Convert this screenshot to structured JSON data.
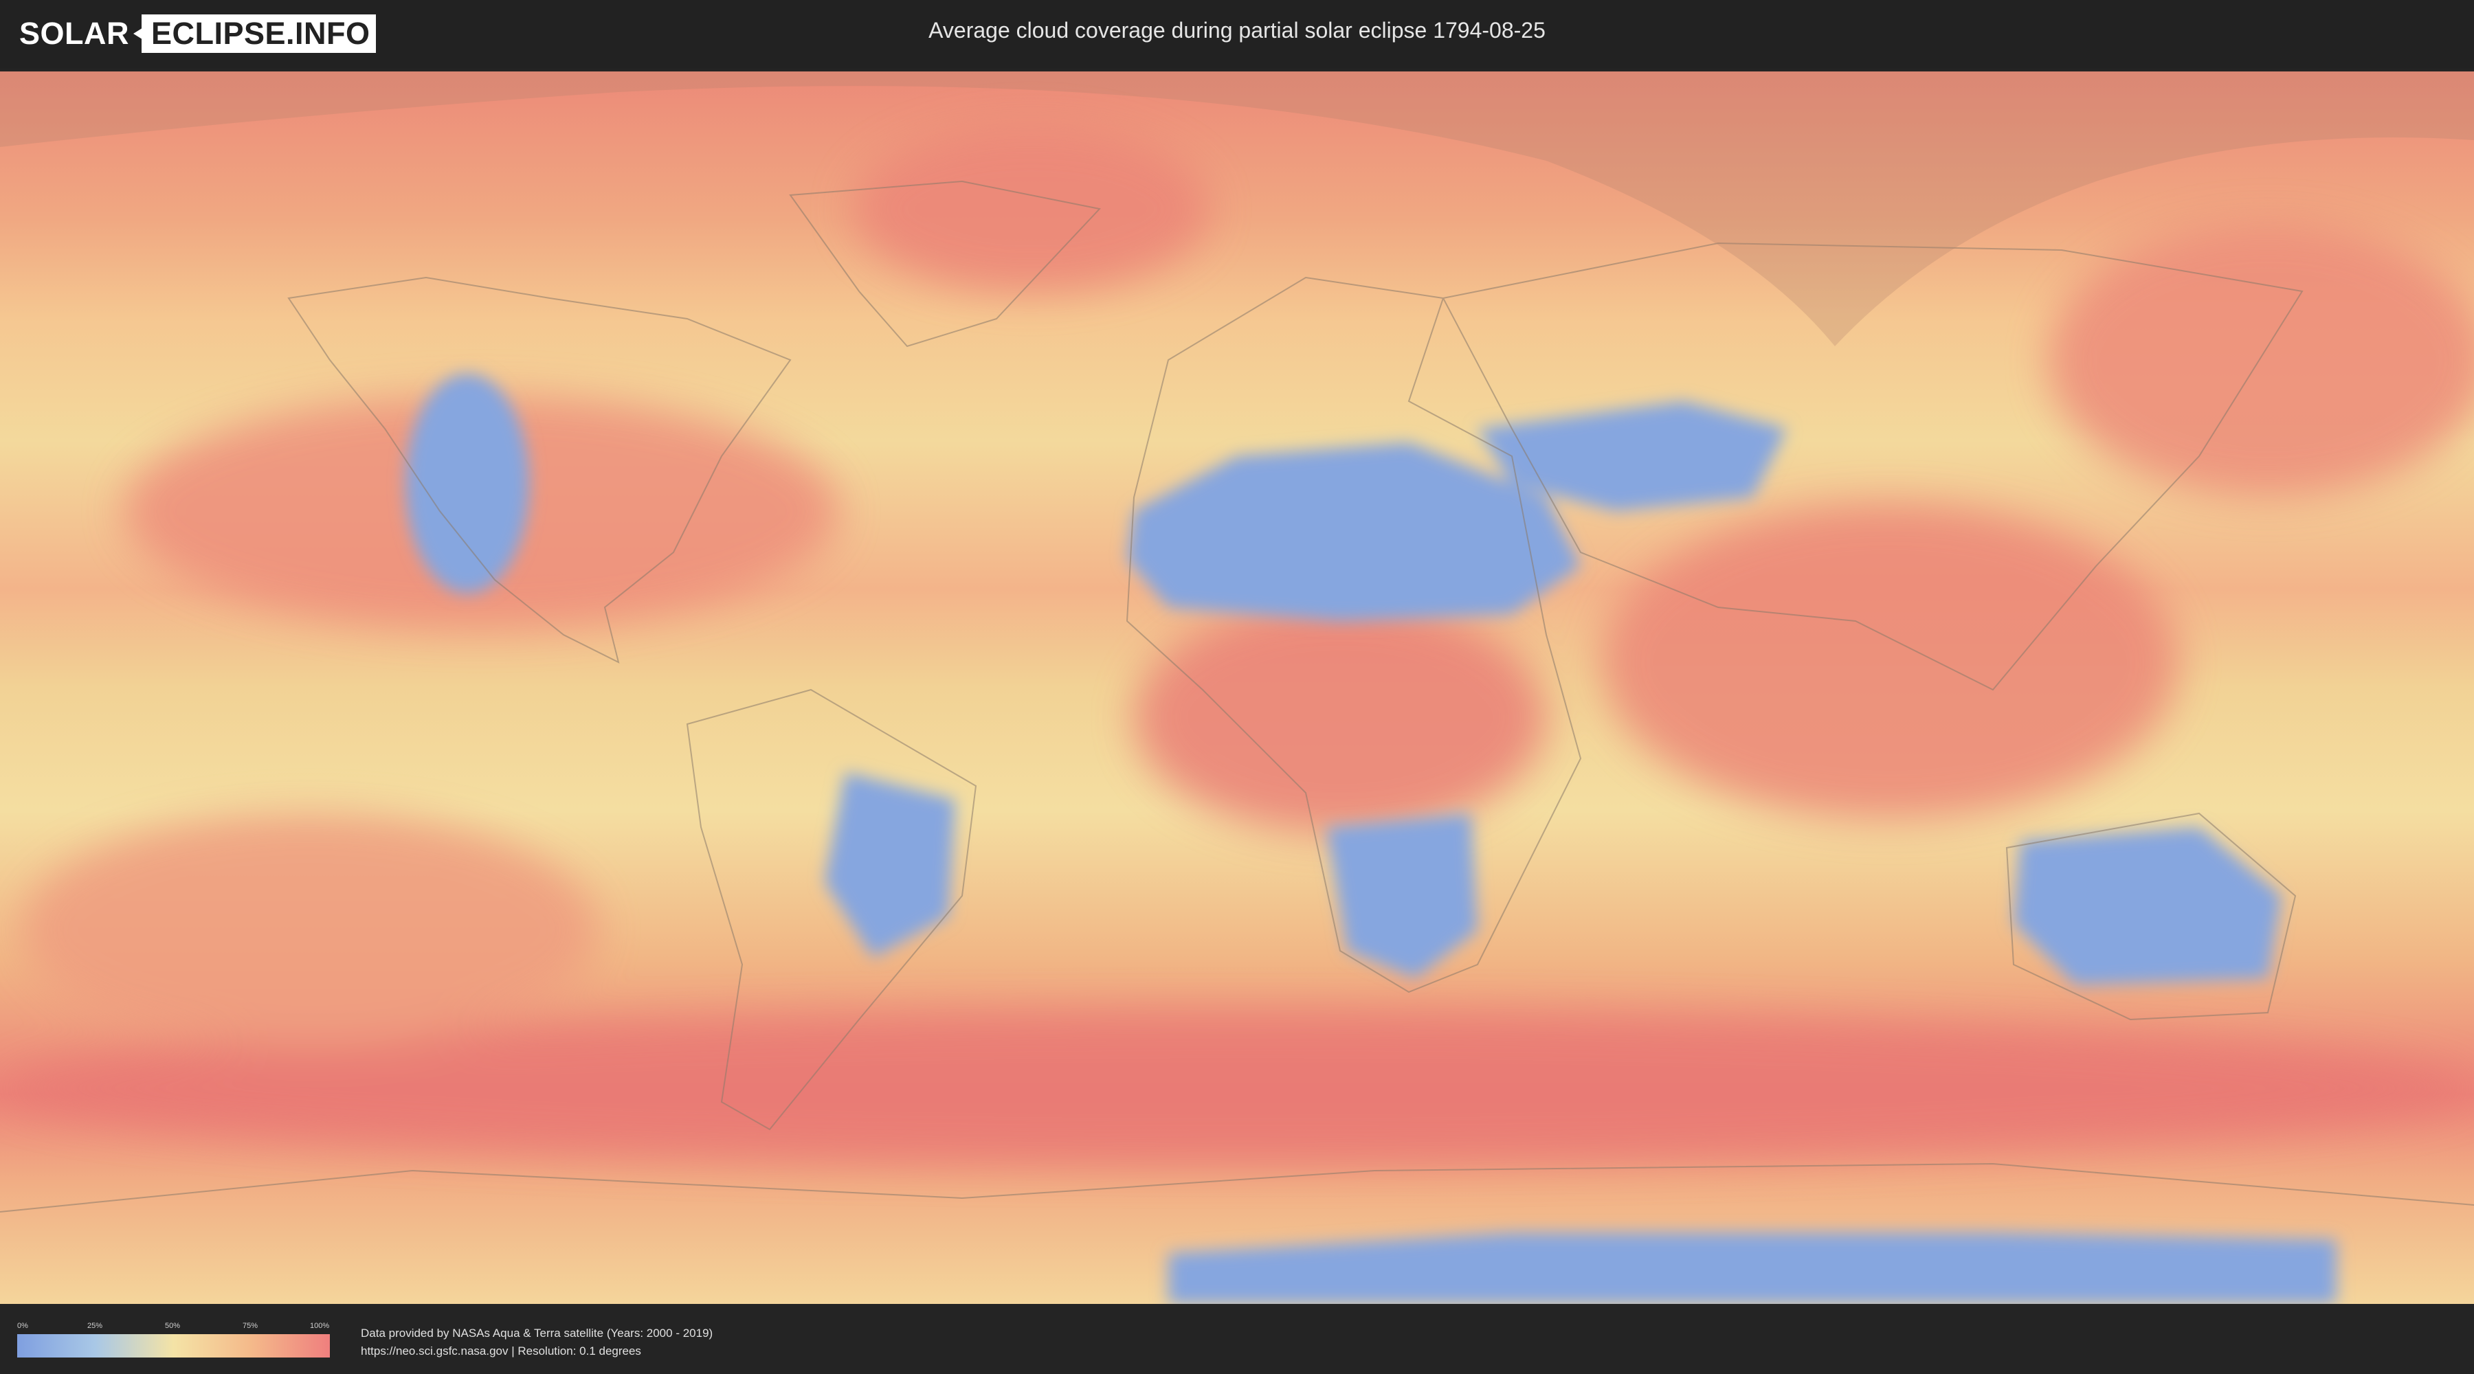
{
  "header": {
    "logo": {
      "part1": "SOLAR",
      "part2": "ECLIPSE.INFO"
    },
    "title": "Average cloud coverage during partial solar eclipse 1794-08-25"
  },
  "map": {
    "legend": {
      "ticks": [
        "0%",
        "25%",
        "50%",
        "75%",
        "100%"
      ],
      "colors": [
        "#7f9fe0",
        "#a9c8e6",
        "#f4e3a6",
        "#f4b98a",
        "#ef7f7e"
      ]
    }
  },
  "footer": {
    "credit_line1": "Data provided by NASAs Aqua & Terra satellite (Years: 2000 - 2019)",
    "credit_line2": "https://neo.sci.gsfc.nasa.gov | Resolution: 0.1 degrees"
  }
}
